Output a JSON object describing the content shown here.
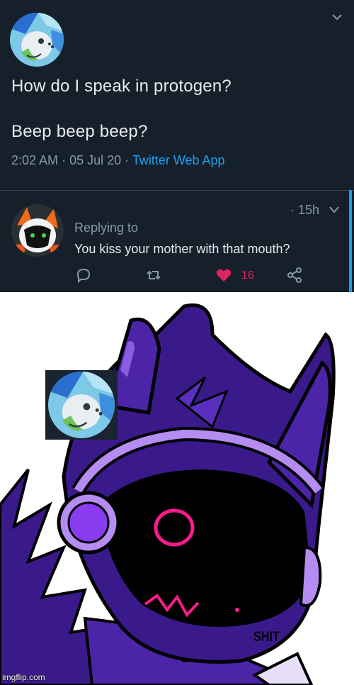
{
  "tweet": {
    "line1": "How do I speak in protogen?",
    "line2": "Beep beep beep?",
    "time": "2:02 AM",
    "sep": "·",
    "date": "05 Jul 20",
    "app": "Twitter Web App"
  },
  "reply": {
    "time": "· 15h",
    "replying_to": "Replying to",
    "text": "You kiss your mother with that mouth?",
    "like_count": "16"
  },
  "meme": {
    "caption": "SHIT",
    "watermark": "imgflip.com"
  },
  "colors": {
    "background": "#15202b",
    "text": "#e8eaec",
    "muted": "#8899a6",
    "link": "#1da1f2",
    "like": "#e0245e"
  },
  "icons": [
    "chevron-down-icon",
    "reply-icon",
    "retweet-icon",
    "heart-icon",
    "share-icon"
  ]
}
